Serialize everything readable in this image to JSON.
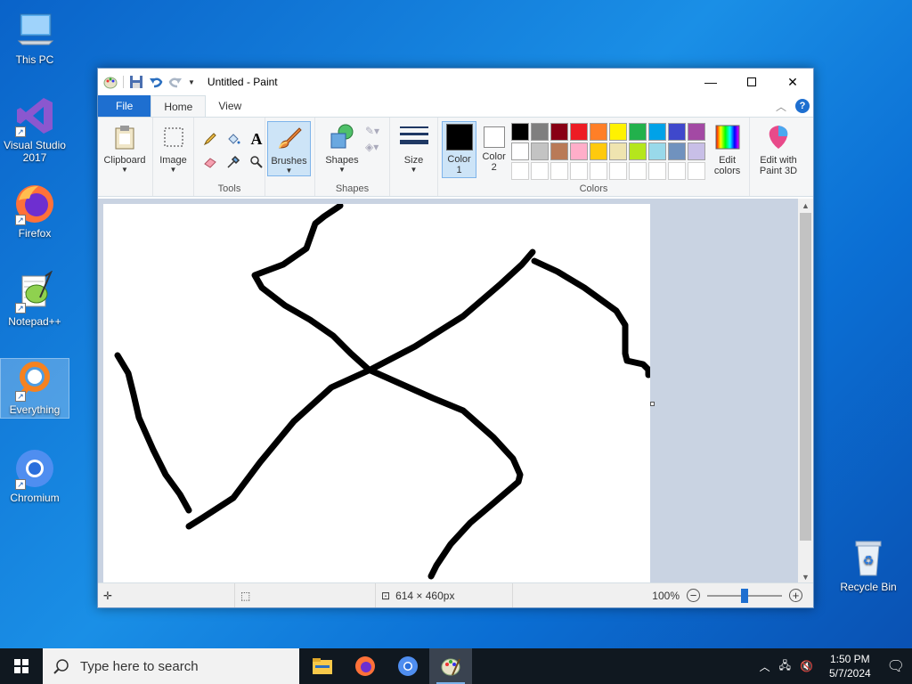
{
  "desktop": {
    "icons": [
      {
        "label": "This PC",
        "icon": "computer-icon"
      },
      {
        "label": "Visual Studio 2017",
        "icon": "visual-studio-icon"
      },
      {
        "label": "Firefox",
        "icon": "firefox-icon"
      },
      {
        "label": "Notepad++",
        "icon": "notepadpp-icon"
      },
      {
        "label": "Everything",
        "icon": "everything-search-icon"
      },
      {
        "label": "Chromium",
        "icon": "chromium-icon"
      },
      {
        "label": "Recycle Bin",
        "icon": "recycle-bin-icon"
      }
    ]
  },
  "paint": {
    "title": "Untitled - Paint",
    "tabs": {
      "file": "File",
      "home": "Home",
      "view": "View"
    },
    "help": "?",
    "ribbon": {
      "clipboard": "Clipboard",
      "image": "Image",
      "tools": "Tools",
      "brushes": "Brushes",
      "shapes": "Shapes",
      "shapes_group": "Shapes",
      "size": "Size",
      "color1": "Color\n1",
      "color1_line1": "Color",
      "color1_line2": "1",
      "color2_line1": "Color",
      "color2_line2": "2",
      "colors_group": "Colors",
      "edit_colors_line1": "Edit",
      "edit_colors_line2": "colors",
      "paint3d_line1": "Edit with",
      "paint3d_line2": "Paint 3D"
    },
    "palette": [
      "#000000",
      "#7f7f7f",
      "#880015",
      "#ed1c24",
      "#ff7f27",
      "#fff200",
      "#22b14c",
      "#00a2e8",
      "#3f48cc",
      "#a349a4",
      "#ffffff",
      "#c3c3c3",
      "#b97a57",
      "#ffaec9",
      "#ffc90e",
      "#efe4b0",
      "#b5e61d",
      "#99d9ea",
      "#7092be",
      "#c8bfe7"
    ],
    "color1": "#000000",
    "color2": "#ffffff",
    "status": {
      "dimensions": "614 × 460px",
      "zoom": "100%"
    }
  },
  "taskbar": {
    "search_placeholder": "Type here to search",
    "time": "1:50 PM",
    "date": "5/7/2024"
  }
}
